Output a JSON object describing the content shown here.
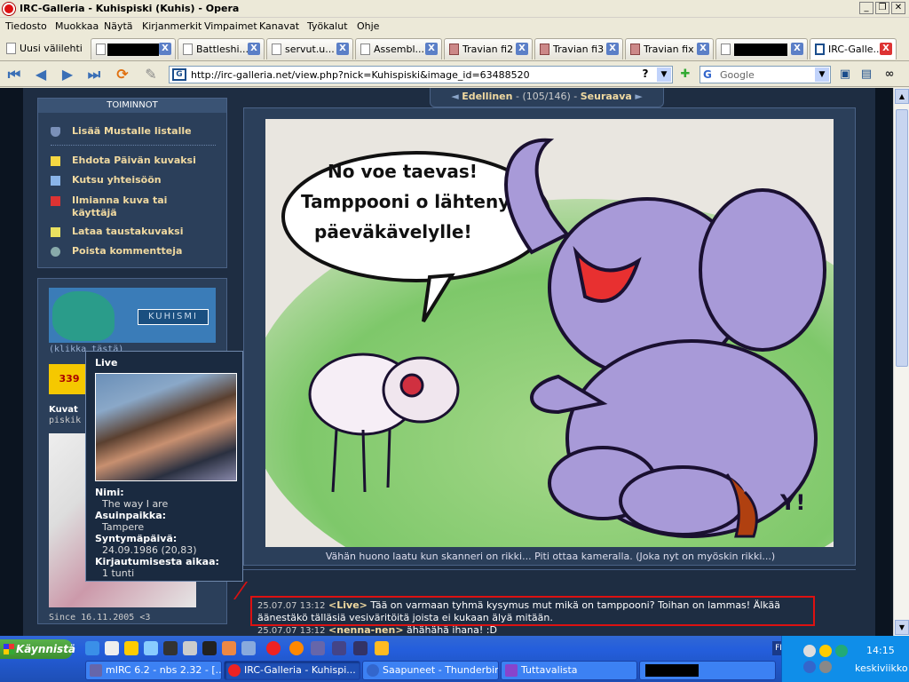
{
  "window": {
    "title": "IRC-Galleria - Kuhispiski (Kuhis) - Opera",
    "minimize": "_",
    "maximize": "❐",
    "close": "✕"
  },
  "menu": [
    "Tiedosto",
    "Muokkaa",
    "Näytä",
    "Kirjanmerkit",
    "Vimpaimet",
    "Kanavat",
    "Työkalut",
    "Ohje"
  ],
  "tabs": [
    {
      "label": "Uusi välilehti"
    },
    {
      "label": ""
    },
    {
      "label": "Battleshi..."
    },
    {
      "label": "servut.u..."
    },
    {
      "label": "Assembl..."
    },
    {
      "label": "Travian fi2"
    },
    {
      "label": "Travian fi3"
    },
    {
      "label": "Travian fix"
    },
    {
      "label": ""
    },
    {
      "label": "IRC-Galle..."
    }
  ],
  "tab_close": "X",
  "address": {
    "url": "http://irc-galleria.net/view.php?nick=Kuhispiski&image_id=63488520",
    "help": "?",
    "search_placeholder": "Google",
    "g_icon": "G",
    "dropdown": "▼"
  },
  "sidebar": {
    "header": "TOIMINNOT",
    "items": [
      "Lisää Mustalle listalle",
      "Ehdota Päivän kuvaksi",
      "Kutsu yhteisöön",
      "Ilmianna kuva tai käyttäjä",
      "Lataa taustakuvaksi",
      "Poista kommentteja"
    ]
  },
  "profile": {
    "banner_text": "KUHISMI",
    "click_here": "(klikka tästä)",
    "badge": "339",
    "kuvat": "Kuvat",
    "kuvat_sub": "piskik",
    "since": "Since 16.11.2005 <3"
  },
  "popup": {
    "title": "Live",
    "fields": [
      {
        "label": "Nimi:",
        "value": "The way I are"
      },
      {
        "label": "Asuinpaikka:",
        "value": "Tampere"
      },
      {
        "label": "Syntymäpäivä:",
        "value": "24.09.1986 (20,83)"
      },
      {
        "label": "Kirjautumisesta aikaa:",
        "value": "1 tunti"
      }
    ]
  },
  "image_nav": {
    "prev_arrow": "◄",
    "prev": "Edellinen",
    "position": "(105/146)",
    "sep": "-",
    "next": "Seuraava",
    "next_arrow": "►"
  },
  "cartoon": {
    "bubble_line1": "No voe taevas!",
    "bubble_line2": "Tamppooni o lähteny",
    "bubble_line3": "päeväkävelylle!"
  },
  "caption": "Vähän huono laatu kun skanneri on rikki... Piti ottaa kameralla. (Joka nyt on myöskin rikki...)",
  "comments": [
    {
      "time": "25.07.07 13:12",
      "nick": "<Live>",
      "line1": "Tää on varmaan tyhmä kysymus mut mikä on tamppooni? Toihan on lammas! Älkää",
      "line2": "äänestäkö tälläsiä vesiväritöitä joista ei kukaan älyä mitään."
    },
    {
      "time": "25.07.07 13:12",
      "nick": "<nenna-nen>",
      "line1": "ähähähä ihana! :D",
      "line2": ""
    }
  ],
  "taskbar": {
    "start": "Käynnistä",
    "items": [
      "mIRC 6.2 - nbs 2.32 - [...",
      "IRC-Galleria - Kuhispi...",
      "Saapuneet - Thunderbird",
      "Tuttavalista",
      ""
    ],
    "lang": "FI",
    "time": "14:15",
    "day": "keskiviikko"
  },
  "colors": {
    "link": "#f0d9a0",
    "highlight": "#dd1111",
    "page_bg": "#1e2d42"
  }
}
